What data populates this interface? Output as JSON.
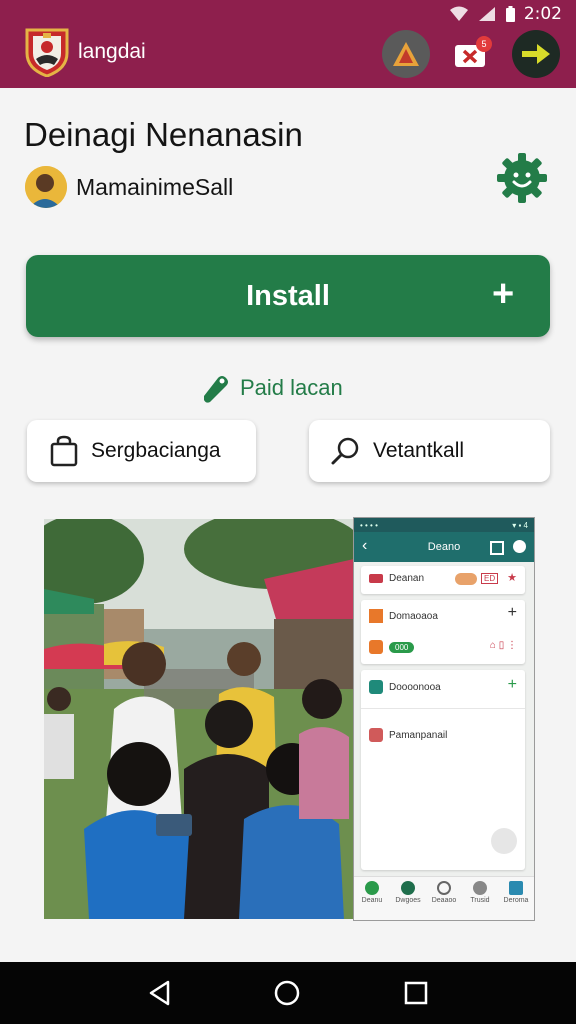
{
  "status_bar": {
    "time": "2:02"
  },
  "app_bar": {
    "title": "langdai",
    "actions": [
      {
        "icon": "warning-icon"
      },
      {
        "icon": "mail-icon",
        "badge": "5"
      },
      {
        "icon": "arrow-right-icon"
      }
    ]
  },
  "app": {
    "name": "Deinagi Nenanasin",
    "developer": "MamainimeSall",
    "settings_icon": "gear-icon"
  },
  "install": {
    "label": "Install",
    "icon": "plus-icon"
  },
  "paid": {
    "label": "Paid lacan",
    "icon": "tag-icon"
  },
  "chips": [
    {
      "label": "Sergbacianga",
      "icon": "bag-icon"
    },
    {
      "label": "Vetantkall",
      "icon": "search-icon"
    }
  ],
  "screenshot_preview": {
    "title": "Deano",
    "rows": [
      {
        "label": "Deanan",
        "badge": "ED"
      },
      {
        "label": "Domaoaoa"
      },
      {
        "label": "",
        "pill": "000"
      },
      {
        "label": "Doooonooa"
      },
      {
        "label": "Pamanpanail"
      }
    ],
    "nav": [
      "Deanu",
      "Dwgoes",
      "Deaaoo",
      "Trusid",
      "Deroma"
    ]
  },
  "colors": {
    "brand": "#8e1f4d",
    "install": "#237c48",
    "preview_header": "#1f6e6c"
  }
}
